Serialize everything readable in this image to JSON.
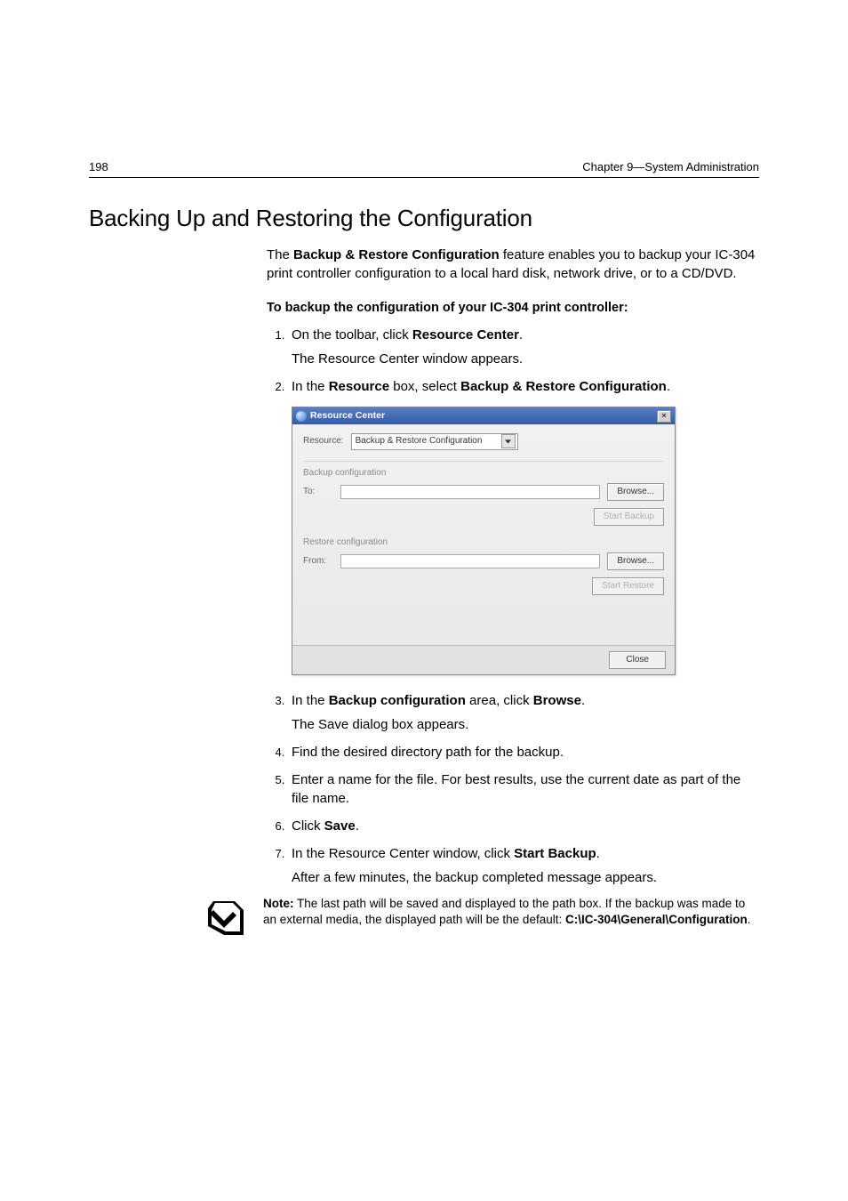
{
  "header": {
    "page_num": "198",
    "chapter": "Chapter 9—System Administration"
  },
  "h1": "Backing Up and Restoring the Configuration",
  "intro": {
    "pre": "The ",
    "bold1": "Backup & Restore Configuration",
    "post": " feature enables you to backup your IC-304 print controller configuration to a local hard disk, network drive, or to a CD/DVD."
  },
  "subhead": "To backup the configuration of your IC-304 print controller:",
  "steps": {
    "s1": {
      "pre": "On the toolbar, click ",
      "bold": "Resource Center",
      "post": ".",
      "after": "The Resource Center window appears."
    },
    "s2": {
      "pre": "In the ",
      "bold1": "Resource",
      "mid": " box, select ",
      "bold2": "Backup & Restore Configuration",
      "post": "."
    },
    "s3": {
      "pre": "In the ",
      "bold1": "Backup configuration",
      "mid": " area, click ",
      "bold2": "Browse",
      "post": ".",
      "after": "The Save dialog box appears."
    },
    "s4": {
      "text": "Find the desired directory path for the backup."
    },
    "s5": {
      "text": "Enter a name for the file. For best results, use the current date as part of the file name."
    },
    "s6": {
      "pre": "Click ",
      "bold": "Save",
      "post": "."
    },
    "s7": {
      "pre": "In the Resource Center window, click ",
      "bold": "Start Backup",
      "post": ".",
      "after": "After a few minutes, the backup completed message appears."
    }
  },
  "dialog": {
    "title": "Resource Center",
    "resource_label": "Resource:",
    "resource_value": "Backup & Restore Configuration",
    "backup_section": "Backup configuration",
    "to_label": "To:",
    "browse": "Browse...",
    "start_backup": "Start Backup",
    "restore_section": "Restore configuration",
    "from_label": "From:",
    "start_restore": "Start Restore",
    "close": "Close"
  },
  "note": {
    "label": "Note:",
    "text1": "  The last path will be saved and displayed to the path box. If the backup was made to an external media, the displayed path will be the default: ",
    "bold_path": "C:\\IC-304\\General\\Configuration",
    "post": "."
  }
}
